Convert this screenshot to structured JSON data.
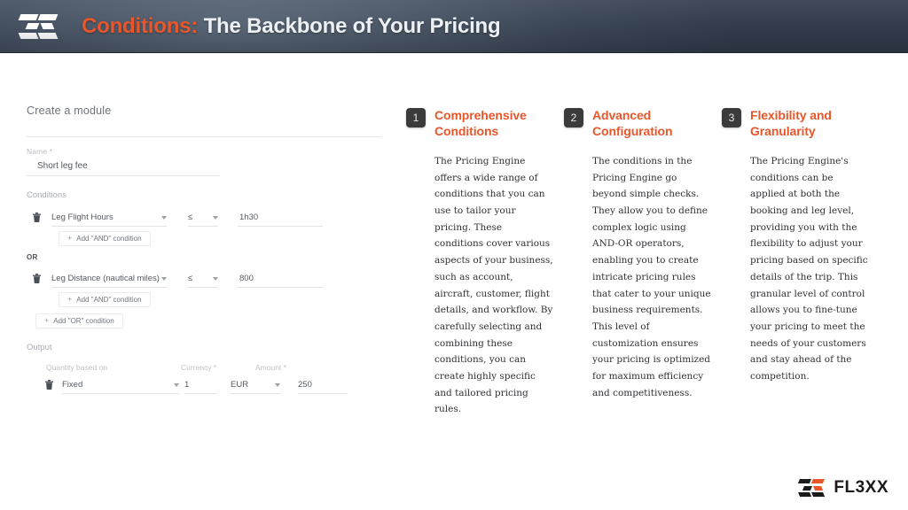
{
  "header": {
    "logo_icon": "fl3xx-logo-icon",
    "title_accent": "Conditions:",
    "title_rest": " The Backbone of Your Pricing"
  },
  "form": {
    "title": "Create a module",
    "name_label": "Name *",
    "name_value": "Short leg fee",
    "conditions_label": "Conditions",
    "or_separator": "OR",
    "add_and_label": "Add \"AND\" condition",
    "add_or_label": "Add \"OR\" condition",
    "plus_glyph": "+",
    "conditions": [
      {
        "field": "Leg Flight Hours",
        "operator": "≤",
        "value": "1h30"
      },
      {
        "field": "Leg Distance (nautical miles)",
        "operator": "≤",
        "value": "800"
      }
    ],
    "output_label": "Output",
    "output": {
      "quantity_label": "Quantity based on",
      "quantity_value": "Fixed",
      "quantity_number": "1",
      "currency_label": "Currency *",
      "currency_value": "EUR",
      "amount_label": "Amount *",
      "amount_value": "250"
    }
  },
  "columns": [
    {
      "number": "1",
      "title": "Comprehensive Conditions",
      "body": "The Pricing Engine offers a wide range of conditions that you can use to tailor your pricing. These conditions cover various aspects of your business, such as account, aircraft, customer, flight details, and workflow. By carefully selecting and combining these conditions, you can create highly specific and tailored pricing rules."
    },
    {
      "number": "2",
      "title": "Advanced Configuration",
      "body": "The conditions in the Pricing Engine go beyond simple checks. They allow you to define complex logic using AND-OR operators, enabling you to create intricate pricing rules that cater to your unique business requirements. This level of customization ensures your pricing is optimized for maximum efficiency and competitiveness."
    },
    {
      "number": "3",
      "title": "Flexibility and Granularity",
      "body": "The Pricing Engine's conditions can be applied at both the booking and leg level, providing you with the flexibility to adjust your pricing based on specific details of the trip. This granular level of control allows you to fine-tune your pricing to meet the needs of your customers and stay ahead of the competition."
    }
  ],
  "footer": {
    "logo_icon": "fl3xx-logo-icon",
    "wordmark": "FL3XX"
  },
  "colors": {
    "accent_orange": "#E8562A",
    "header_dark": "#3b4657",
    "badge_dark": "#3b3b3b",
    "body_text": "#2f3134"
  }
}
